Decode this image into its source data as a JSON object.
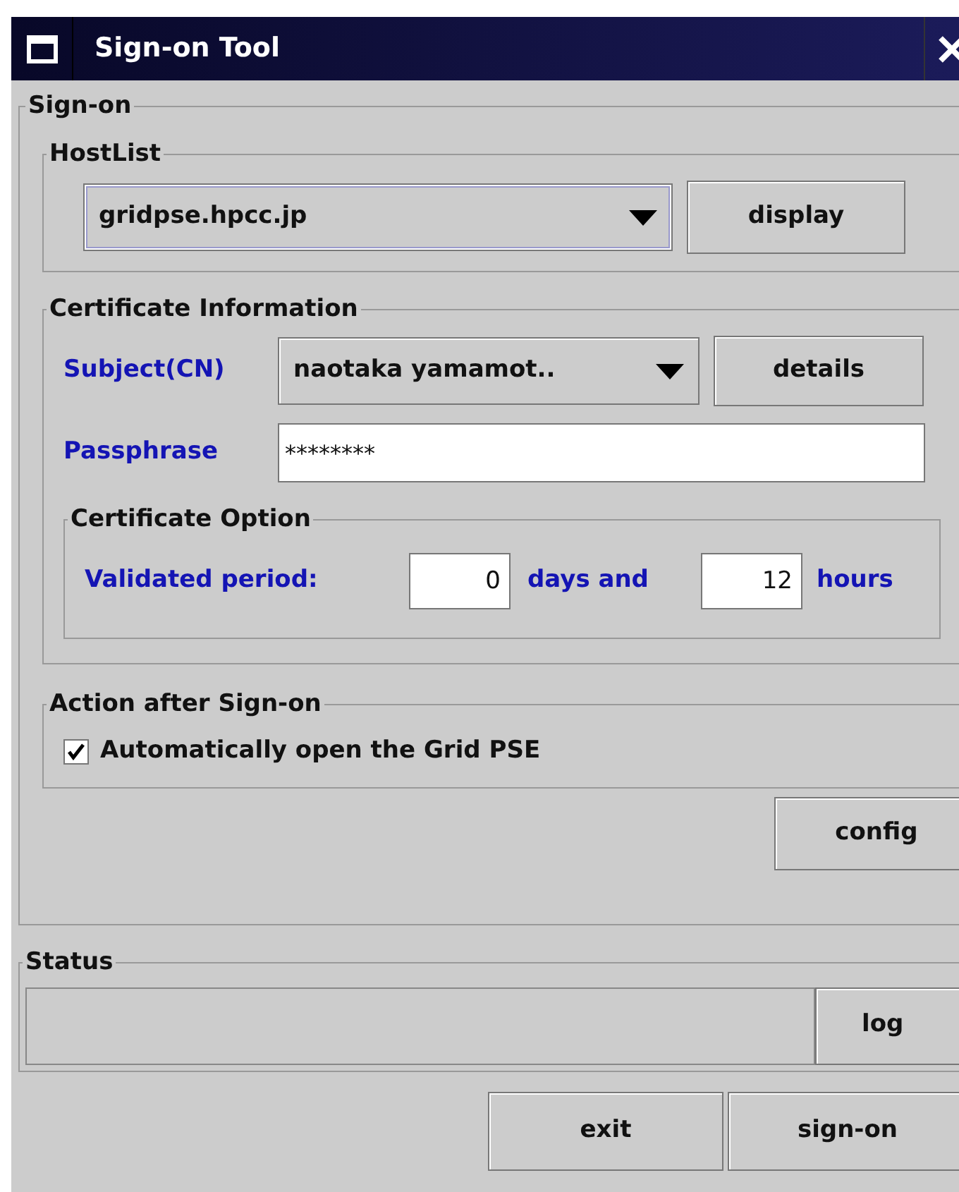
{
  "window": {
    "title": "Sign-on Tool"
  },
  "sign_on": {
    "legend": "Sign-on",
    "host_list": {
      "legend": "HostList",
      "host": "gridpse.hpcc.jp",
      "button": "display"
    },
    "certificate_information": {
      "legend": "Certificate Information",
      "subject_label": "Subject(CN)",
      "subject": "naotaka yamamot..",
      "details_button": "details",
      "passphrase_label": "Passphrase",
      "passphrase": "********",
      "certificate_option": {
        "legend": "Certificate Option",
        "label": "Validated period:",
        "days": "0",
        "days_label": "days and",
        "hours": "12",
        "hours_label": "hours"
      }
    },
    "action_after_sign_on": {
      "legend": "Action after Sign-on",
      "checkbox": {
        "label": "Automatically open the Grid PSE",
        "checked": true
      }
    },
    "config_button": "config"
  },
  "status": {
    "legend": "Status",
    "button": "log"
  },
  "buttons": [
    "exit",
    "sign-on"
  ]
}
